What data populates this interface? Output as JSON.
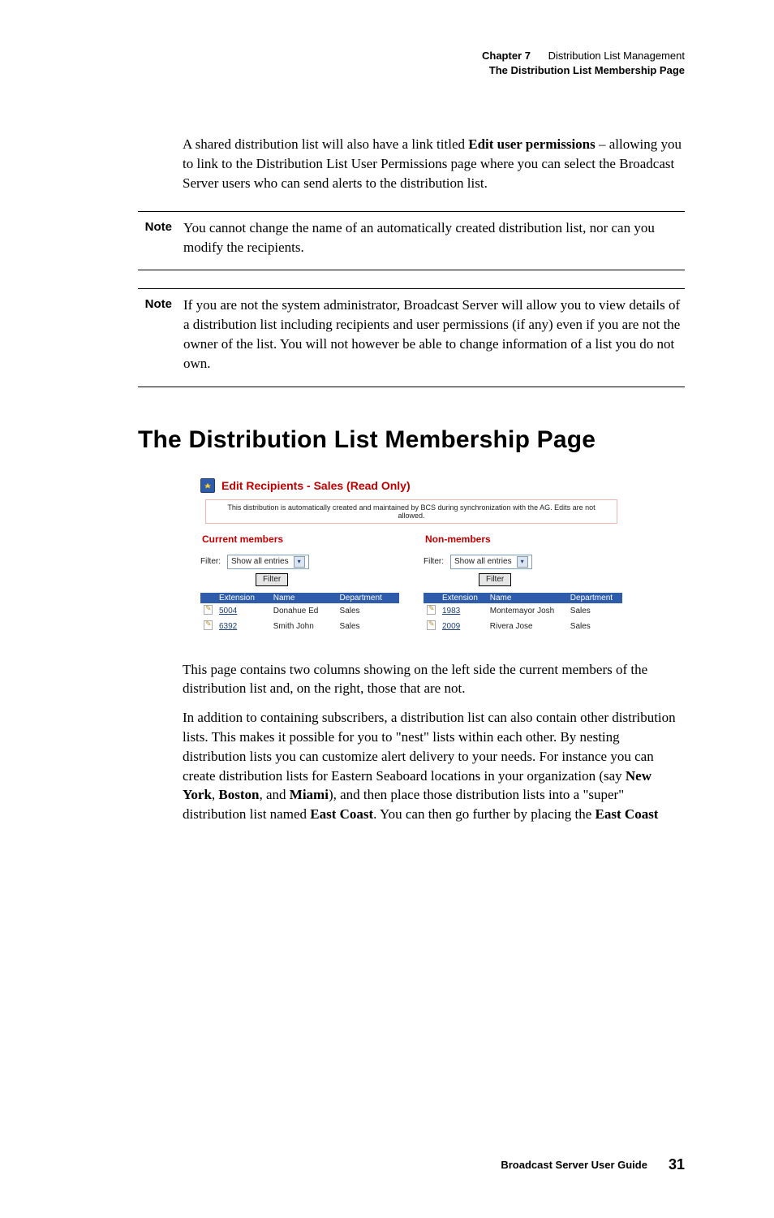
{
  "header": {
    "chapter_label": "Chapter 7",
    "chapter_title": "Distribution List Management",
    "section_title": "The Distribution List Membership Page"
  },
  "body": {
    "p1": "A shared distribution list will also have a link titled Edit user permissions – allowing you to link to the Distribution List User Permissions page where you can select the Broadcast Server users who can send alerts to the distribution list.",
    "p1_bold_phrase": "Edit user permissions",
    "note1_label": "Note",
    "note1_text": "You cannot change the name of an automatically created distribution list, nor can you modify the recipients.",
    "note2_label": "Note",
    "note2_text": "If you are not the system administrator, Broadcast Server will allow you to view details of a distribution list including recipients and user permissions (if any) even if you are not the owner of the list. You will not however be able to change information of a list you do not own."
  },
  "heading": "The Distribution List Membership Page",
  "figure": {
    "title": "Edit Recipients - Sales (Read Only)",
    "message": "This distribution is automatically created and maintained by BCS during synchronization with the AG. Edits are not allowed.",
    "left": {
      "title": "Current members",
      "filter_label": "Filter:",
      "select_value": "Show all entries",
      "filter_btn": "Filter",
      "columns": [
        "",
        "Extension",
        "Name",
        "Department"
      ],
      "rows": [
        {
          "ext": "5004",
          "name": "Donahue Ed",
          "dept": "Sales"
        },
        {
          "ext": "6392",
          "name": "Smith John",
          "dept": "Sales"
        }
      ]
    },
    "right": {
      "title": "Non-members",
      "filter_label": "Filter:",
      "select_value": "Show all entries",
      "filter_btn": "Filter",
      "columns": [
        "",
        "Extension",
        "Name",
        "Department"
      ],
      "rows": [
        {
          "ext": "1983",
          "name": "Montemayor Josh",
          "dept": "Sales"
        },
        {
          "ext": "2009",
          "name": "Rivera Jose",
          "dept": "Sales"
        }
      ]
    }
  },
  "body2": {
    "p2": "This page contains two columns showing on the left side the current members of the distribution list and, on the right, those that are not.",
    "p3_part1": "In addition to containing subscribers, a distribution list can also contain other distribution lists. This makes it possible for you to \"nest\" lists within each other. By nesting distribution lists you can customize alert delivery to your needs. For instance you can create distribution lists for Eastern Seaboard locations in your organization (say ",
    "p3_b1": "New York",
    "p3_c1": ", ",
    "p3_b2": "Boston",
    "p3_c2": ", and ",
    "p3_b3": "Miami",
    "p3_part2": "), and then place those distribution lists into a \"super\" distribution list named ",
    "p3_b4": "East Coast",
    "p3_part3": ". You can then go further by placing the ",
    "p3_b5": "East Coast"
  },
  "footer": {
    "title": "Broadcast Server User Guide",
    "page": "31"
  }
}
